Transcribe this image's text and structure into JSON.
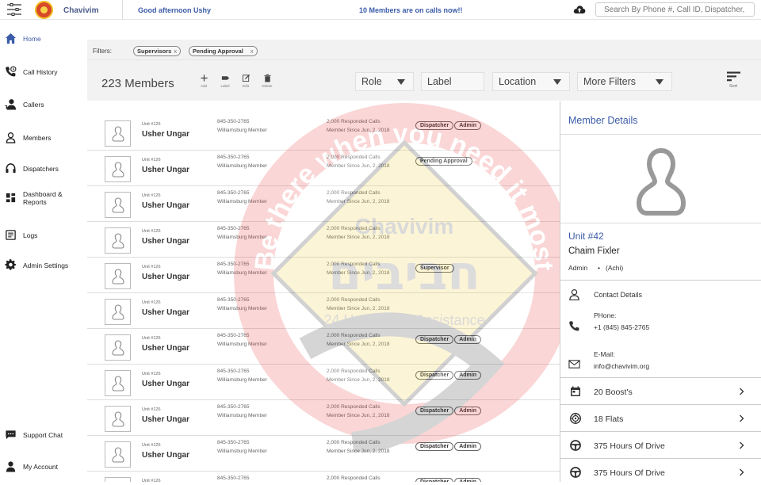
{
  "header": {
    "app_name": "Chavivim",
    "greeting": "Good afternoon Ushy",
    "calls_status": "10 Members are on calls now!!",
    "search_placeholder": "Search By Phone #, Call ID, Dispatcher,"
  },
  "sidebar": {
    "items": [
      {
        "label": "Home",
        "icon": "home-icon",
        "active": true
      },
      {
        "label": "Call History",
        "icon": "call-history-icon"
      },
      {
        "label": "Callers",
        "icon": "callers-icon"
      },
      {
        "label": "Members",
        "icon": "members-icon"
      },
      {
        "label": "Dispatchers",
        "icon": "headset-icon"
      },
      {
        "label": "Dashboard & Reports",
        "icon": "dashboard-icon"
      },
      {
        "label": "Logs",
        "icon": "logs-icon"
      },
      {
        "label": "Admin Settings",
        "icon": "gear-icon"
      },
      {
        "label": "Support Chat",
        "icon": "chat-icon"
      },
      {
        "label": "My Account",
        "icon": "account-icon"
      }
    ]
  },
  "filters": {
    "label": "Filters:",
    "chips": [
      {
        "label": "Supervisors",
        "remove": "x"
      },
      {
        "label": "Pending Approval",
        "remove": "x"
      }
    ]
  },
  "toolbar": {
    "members_count": "223 Members",
    "add_label": "Add",
    "label_label": "Label",
    "edit_label": "Edit",
    "delete_label": "Delete",
    "role": "Role",
    "label_field": "Label",
    "location": "Location",
    "more_filters": "More Filters",
    "sort_label": "Sort"
  },
  "members": [
    {
      "unit": "Unit #126",
      "name": "Usher Ungar",
      "phone": "845-350-2765",
      "location": "Williamsburg Member",
      "calls": "2,000 Responded Calls",
      "since": "Member Since Jun, 2, 2018",
      "badges": [
        "Dispatcher",
        "Admin"
      ]
    },
    {
      "unit": "Unit #126",
      "name": "Usher Ungar",
      "phone": "845-350-2765",
      "location": "Williamsburg Member",
      "calls": "2,000 Responded Calls",
      "since": "Member Since Jun, 2, 2018",
      "badges": [
        "Pending Approval"
      ]
    },
    {
      "unit": "Unit #126",
      "name": "Usher Ungar",
      "phone": "845-350-2765",
      "location": "Williamsburg Member",
      "calls": "2,000 Responded Calls",
      "since": "Member Since Jun, 2, 2018",
      "badges": []
    },
    {
      "unit": "Unit #126",
      "name": "Usher Ungar",
      "phone": "845-350-2765",
      "location": "Williamsburg Member",
      "calls": "2,000 Responded Calls",
      "since": "Member Since Jun, 2, 2018",
      "badges": []
    },
    {
      "unit": "Unit #126",
      "name": "Usher Ungar",
      "phone": "845-350-2765",
      "location": "Williamsburg Member",
      "calls": "2,000 Responded Calls",
      "since": "Member Since Jun, 2, 2018",
      "badges": [
        "Supervisor"
      ]
    },
    {
      "unit": "Unit #126",
      "name": "Usher Ungar",
      "phone": "845-350-2765",
      "location": "Williamsburg Member",
      "calls": "2,000 Responded Calls",
      "since": "Member Since Jun, 2, 2018",
      "badges": []
    },
    {
      "unit": "Unit #126",
      "name": "Usher Ungar",
      "phone": "845-350-2765",
      "location": "Williamsburg Member",
      "calls": "2,000 Responded Calls",
      "since": "Member Since Jun, 2, 2018",
      "badges": [
        "Dispatcher",
        "Admin"
      ]
    },
    {
      "unit": "Unit #126",
      "name": "Usher Ungar",
      "phone": "845-350-2765",
      "location": "Williamsburg Member",
      "calls": "2,000 Responded Calls",
      "since": "Member Since Jun, 2, 2018",
      "badges": [
        "Dispatcher",
        "Admin"
      ]
    },
    {
      "unit": "Unit #126",
      "name": "Usher Ungar",
      "phone": "845-350-2765",
      "location": "Williamsburg Member",
      "calls": "2,000 Responded Calls",
      "since": "Member Since Jun, 2, 2018",
      "badges": [
        "Dispatcher",
        "Admin"
      ]
    },
    {
      "unit": "Unit #126",
      "name": "Usher Ungar",
      "phone": "845-350-2765",
      "location": "Williamsburg Member",
      "calls": "2,000 Responded Calls",
      "since": "Member Since Jun, 2, 2018",
      "badges": [
        "Dispatcher",
        "Admin"
      ]
    },
    {
      "unit": "Unit #126",
      "name": "Usher Ungar",
      "phone": "845-350-2765",
      "location": "Williamsburg Member",
      "calls": "2,000 Responded Calls",
      "since": "Member Since Jun, 2, 2018",
      "badges": [
        "Dispatcher",
        "Admin"
      ]
    }
  ],
  "details": {
    "title": "Member Details",
    "unit": "Unit #42",
    "name": "Chaim Fixler",
    "role": "Admin",
    "dot": "•",
    "nickname": "(Achi)",
    "contact_label": "Contact Details",
    "phone_label": "PHone:",
    "phone_value": "+1 (845) 845-2765",
    "email_label": "E-Mail:",
    "email_value": "info@chavivim.org",
    "stats": [
      {
        "label": "20 Boost's",
        "icon": "calendar-icon"
      },
      {
        "label": "18 Flats",
        "icon": "tire-icon"
      },
      {
        "label": "375 Hours Of Drive",
        "icon": "steering-wheel-icon"
      },
      {
        "label": "375 Hours Of Drive",
        "icon": "steering-wheel-icon"
      }
    ]
  },
  "watermark": {
    "arc_text": "Be there when you need it most",
    "brand": "Chavivim",
    "hebrew": "חביבים",
    "sub": "24 Hour Road Assistance"
  },
  "colors": {
    "accent": "#3a5ba8",
    "panel_bg": "#f2f2f2",
    "watermark_red": "#e94848",
    "watermark_yellow": "#f2cf4a"
  }
}
